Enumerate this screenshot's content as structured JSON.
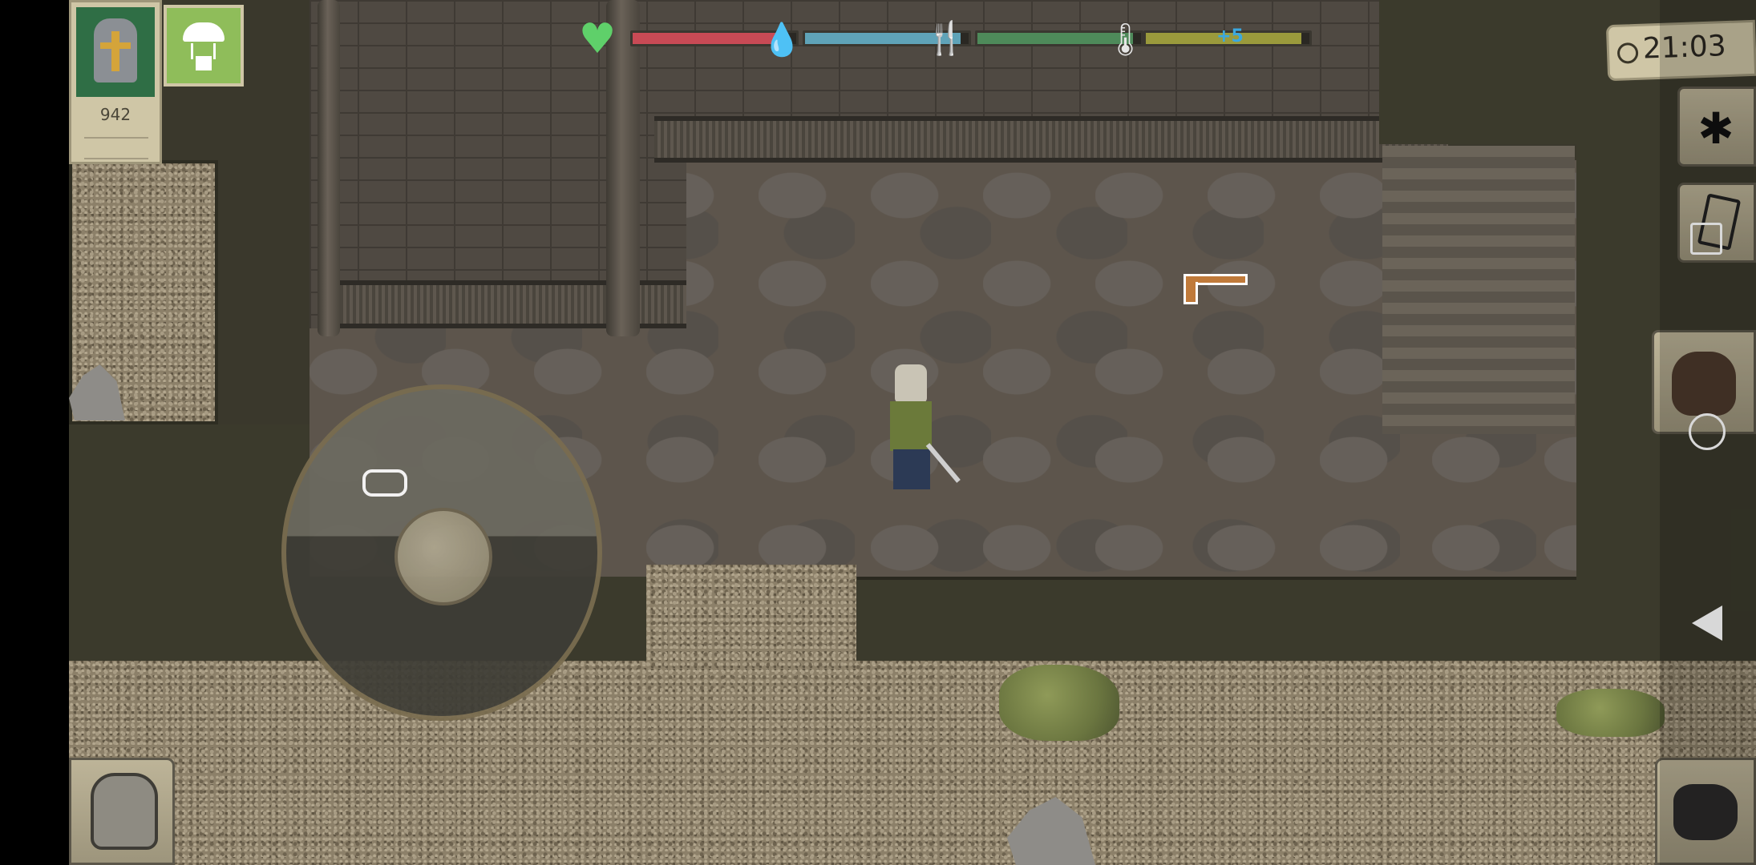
{
  "hud": {
    "player_score": "942",
    "clock_time": "21:03",
    "temperature_label": "+5",
    "status_bars": {
      "health": {
        "level": 0.95,
        "color": "#c84a55"
      },
      "thirst": {
        "level": 0.95,
        "color": "#5fa3b8"
      },
      "hunger": {
        "level": 0.95,
        "color": "#4e8a5a"
      },
      "temperature": {
        "level": 0.95,
        "color": "#9a9a3c"
      }
    }
  },
  "icons": {
    "portrait": "knight-helmet-icon",
    "airdrop": "parachute-icon",
    "health": "heart-plus-icon",
    "thirst": "water-drop-icon",
    "hunger": "fork-knife-icon",
    "temperature": "thermometer-icon",
    "clock": "clock-icon",
    "settings": "gear-icon",
    "journal": "notepad-icon",
    "interact": "hand-icon",
    "backpack": "backpack-icon",
    "weapon_swap": "swap-weapon-icon"
  },
  "android_nav": {
    "recent": "square",
    "home": "circle",
    "back": "triangle"
  }
}
